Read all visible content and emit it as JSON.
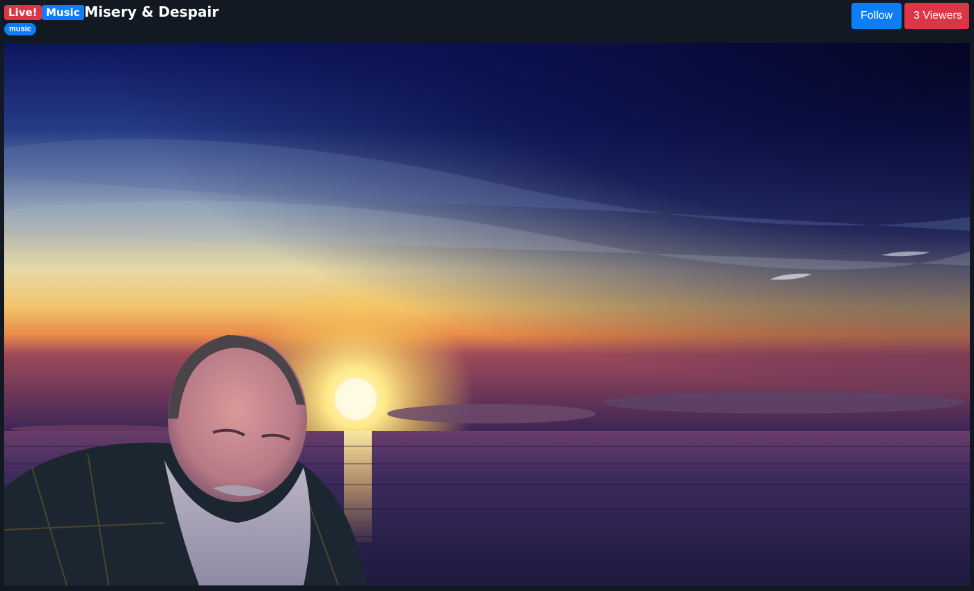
{
  "header": {
    "live_badge": "Live!",
    "category_badge": "Music",
    "title": "Misery & Despair",
    "tag": "music"
  },
  "actions": {
    "follow_label": "Follow",
    "viewers_label": "3 Viewers"
  },
  "colors": {
    "live": "#dc3545",
    "primary": "#0d7ef5",
    "background": "#121923"
  }
}
